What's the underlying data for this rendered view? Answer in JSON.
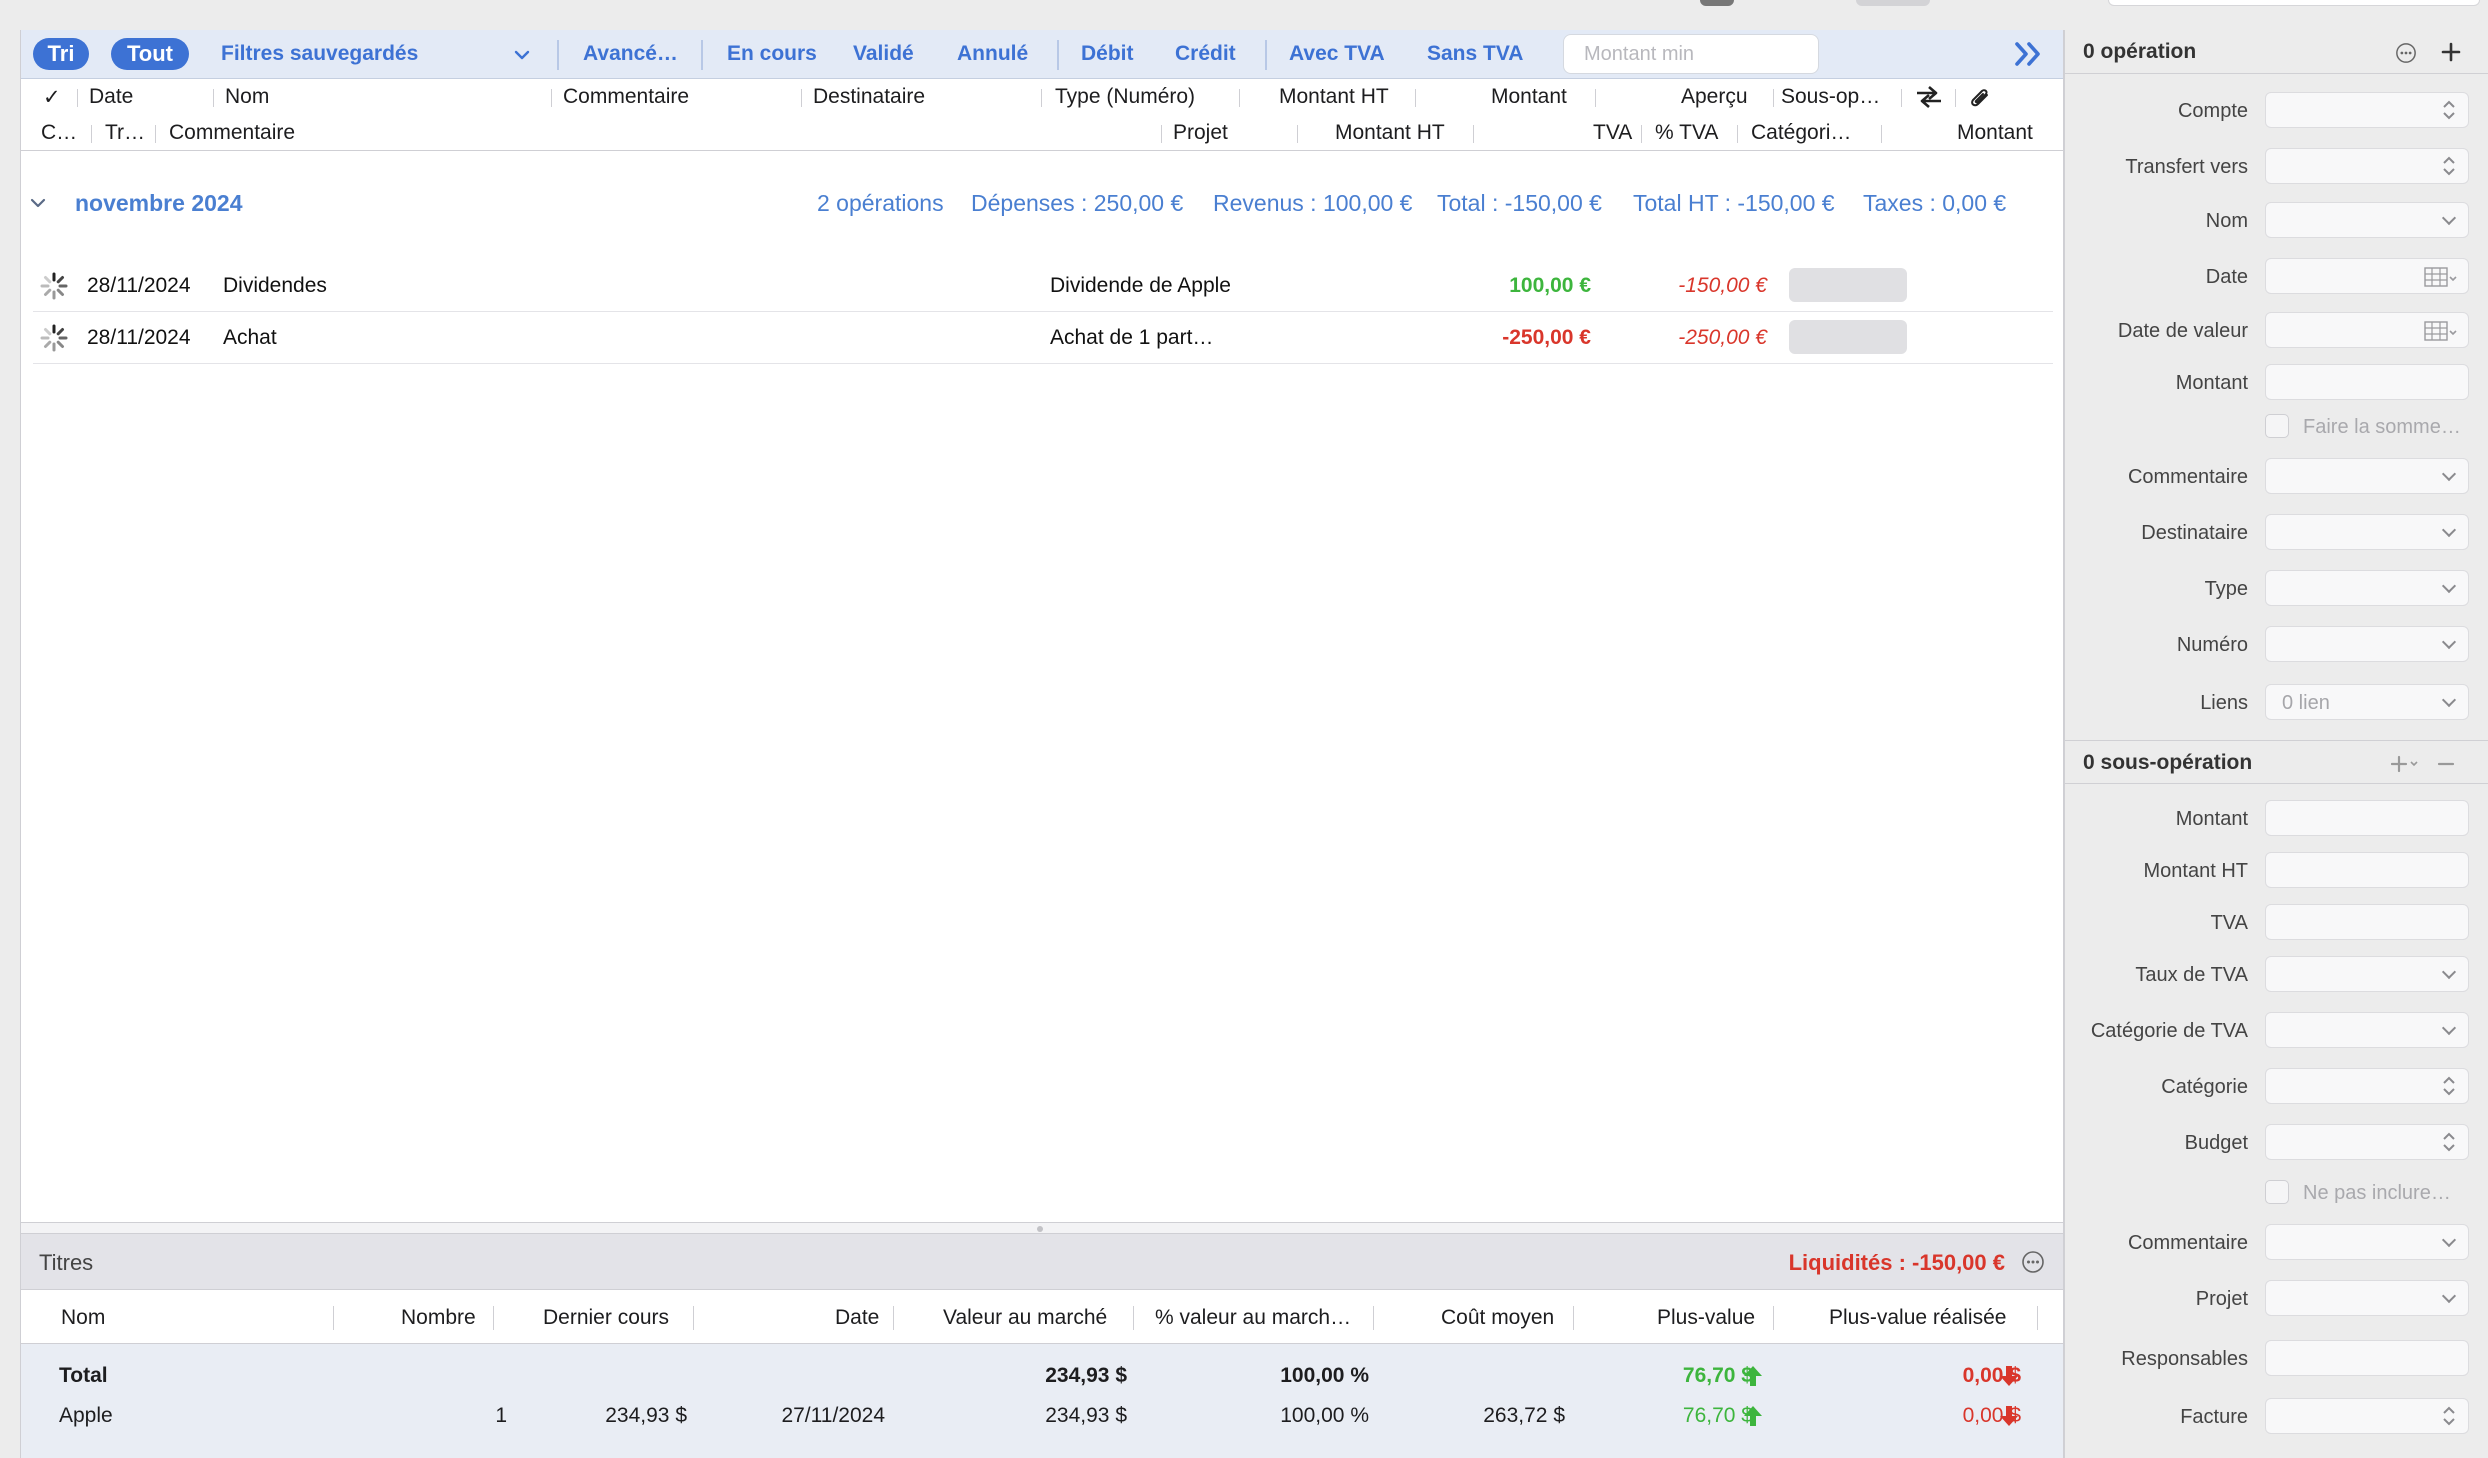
{
  "filterbar": {
    "tri": "Tri",
    "tout": "Tout",
    "saved_filters": "Filtres sauvegardés",
    "advanced": "Avancé…",
    "in_progress": "En cours",
    "validated": "Validé",
    "cancelled": "Annulé",
    "debit": "Débit",
    "credit": "Crédit",
    "with_vat": "Avec TVA",
    "without_vat": "Sans TVA",
    "min_amount_placeholder": "Montant min",
    "accent_color": "#3d72d4"
  },
  "columns_row1": {
    "check": "✓",
    "date": "Date",
    "nom": "Nom",
    "commentaire": "Commentaire",
    "destinataire": "Destinataire",
    "type": "Type (Numéro)",
    "montant_ht": "Montant HT",
    "montant": "Montant",
    "apercu": "Aperçu",
    "sous_op": "Sous-op…"
  },
  "columns_row2": {
    "c": "C…",
    "tr": "Tr…",
    "commentaire": "Commentaire",
    "projet": "Projet",
    "montant_ht": "Montant HT",
    "tva": "TVA",
    "pct_tva": "% TVA",
    "categorie": "Catégori…",
    "montant": "Montant"
  },
  "group": {
    "month": "novembre 2024",
    "count": "2 opérations",
    "expenses": "Dépenses : 250,00 €",
    "income": "Revenus : 100,00 €",
    "total": "Total : -150,00 €",
    "total_ht": "Total HT : -150,00 €",
    "taxes": "Taxes : 0,00 €"
  },
  "operations": [
    {
      "date": "28/11/2024",
      "nom": "Dividendes",
      "type": "Dividende de Apple",
      "montant": "100,00 €",
      "balance": "-150,00 €",
      "sign": "positive"
    },
    {
      "date": "28/11/2024",
      "nom": "Achat",
      "type": "Achat de 1 part…",
      "montant": "-250,00 €",
      "balance": "-250,00 €",
      "sign": "negative"
    }
  ],
  "titres": {
    "title": "Titres",
    "liquidity": "Liquidités : -150,00 €",
    "columns": {
      "nom": "Nom",
      "nombre": "Nombre",
      "dernier_cours": "Dernier cours",
      "date": "Date",
      "valeur_marche": "Valeur au marché",
      "pct_valeur": "% valeur au march…",
      "cout_moyen": "Coût moyen",
      "plus_value": "Plus-value",
      "plus_value_realisee": "Plus-value réalisée"
    },
    "total": {
      "label": "Total",
      "valeur_marche": "234,93 $",
      "pct_valeur": "100,00 %",
      "plus_value": "76,70 $",
      "plus_value_realisee": "0,00 $"
    },
    "rows": [
      {
        "nom": "Apple",
        "nombre": "1",
        "dernier_cours": "234,93 $",
        "date": "27/11/2024",
        "valeur_marche": "234,93 $",
        "pct_valeur": "100,00 %",
        "cout_moyen": "263,72 $",
        "plus_value": "76,70 $",
        "plus_value_realisee": "0,00 $"
      }
    ]
  },
  "inspector": {
    "operations_title": "0 opération",
    "labels": {
      "compte": "Compte",
      "transfert": "Transfert vers",
      "nom": "Nom",
      "date": "Date",
      "date_valeur": "Date de valeur",
      "montant": "Montant",
      "faire_somme": "Faire la somme…",
      "commentaire": "Commentaire",
      "destinataire": "Destinataire",
      "type": "Type",
      "numero": "Numéro",
      "liens": "Liens"
    },
    "liens_value": "0 lien",
    "sub_title": "0 sous-opération",
    "sub_labels": {
      "montant": "Montant",
      "montant_ht": "Montant HT",
      "tva": "TVA",
      "taux_tva": "Taux de TVA",
      "categorie_tva": "Catégorie de TVA",
      "categorie": "Catégorie",
      "budget": "Budget",
      "ne_pas_inclure": "Ne pas inclure…",
      "commentaire": "Commentaire",
      "projet": "Projet",
      "responsables": "Responsables",
      "facture": "Facture"
    }
  }
}
